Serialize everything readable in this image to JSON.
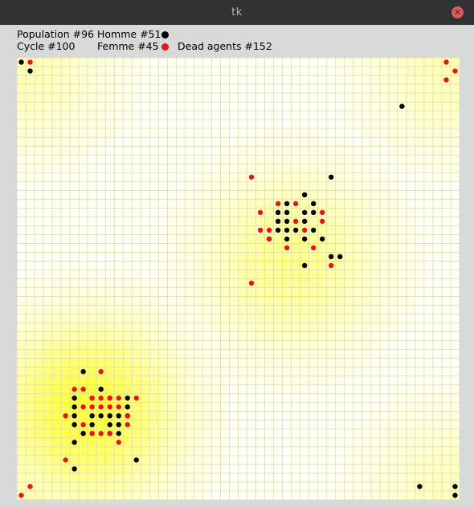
{
  "window": {
    "title": "tk",
    "close_glyph": "✕"
  },
  "stats": {
    "population": "Population #96",
    "cycle": "Cycle #100",
    "homme": "Homme #51",
    "femme": "Femme #45",
    "dead": "Dead agents #152"
  },
  "colors": {
    "homme": "#000000",
    "femme": "#e8141c",
    "hotspot": "#ffff33",
    "grid": "#dcdcb4"
  },
  "grid": {
    "columns": 50,
    "rows": 50
  },
  "resource_hotspots": [
    {
      "col": 7.5,
      "row": 39.5,
      "strength": 1.0
    },
    {
      "col": 30.5,
      "row": 22.5,
      "strength": 0.55
    },
    {
      "col": 0,
      "row": 0,
      "strength": 0.35
    },
    {
      "col": 49,
      "row": 0,
      "strength": 0.35
    },
    {
      "col": 0,
      "row": 49,
      "strength": 0.35
    },
    {
      "col": 49,
      "row": 49,
      "strength": 0.3
    }
  ],
  "agents": {
    "homme": [
      [
        0,
        0
      ],
      [
        1,
        1
      ],
      [
        43,
        5
      ],
      [
        35,
        13
      ],
      [
        32,
        15
      ],
      [
        30,
        16
      ],
      [
        33,
        16
      ],
      [
        29,
        17
      ],
      [
        30,
        17
      ],
      [
        32,
        17
      ],
      [
        33,
        17
      ],
      [
        29,
        18
      ],
      [
        30,
        18
      ],
      [
        32,
        18
      ],
      [
        29,
        19
      ],
      [
        30,
        19
      ],
      [
        31,
        19
      ],
      [
        33,
        19
      ],
      [
        28,
        20
      ],
      [
        30,
        20
      ],
      [
        32,
        20
      ],
      [
        34,
        20
      ],
      [
        35,
        22
      ],
      [
        36,
        22
      ],
      [
        32,
        23
      ],
      [
        7,
        35
      ],
      [
        9,
        37
      ],
      [
        6,
        38
      ],
      [
        8,
        38
      ],
      [
        10,
        38
      ],
      [
        12,
        38
      ],
      [
        6,
        39
      ],
      [
        12,
        39
      ],
      [
        6,
        40
      ],
      [
        8,
        40
      ],
      [
        9,
        40
      ],
      [
        10,
        40
      ],
      [
        11,
        40
      ],
      [
        12,
        40
      ],
      [
        6,
        41
      ],
      [
        8,
        41
      ],
      [
        10,
        41
      ],
      [
        11,
        41
      ],
      [
        7,
        42
      ],
      [
        10,
        42
      ],
      [
        11,
        42
      ],
      [
        6,
        43
      ],
      [
        13,
        45
      ],
      [
        6,
        46
      ],
      [
        45,
        48
      ],
      [
        49,
        48
      ],
      [
        49,
        49
      ]
    ],
    "femme": [
      [
        1,
        0
      ],
      [
        48,
        0
      ],
      [
        49,
        1
      ],
      [
        48,
        2
      ],
      [
        26,
        13
      ],
      [
        29,
        16
      ],
      [
        31,
        16
      ],
      [
        27,
        17
      ],
      [
        34,
        17
      ],
      [
        31,
        18
      ],
      [
        34,
        18
      ],
      [
        27,
        19
      ],
      [
        28,
        19
      ],
      [
        32,
        19
      ],
      [
        28,
        20
      ],
      [
        30,
        21
      ],
      [
        33,
        21
      ],
      [
        35,
        23
      ],
      [
        26,
        25
      ],
      [
        9,
        35
      ],
      [
        6,
        37
      ],
      [
        7,
        37
      ],
      [
        8,
        38
      ],
      [
        9,
        38
      ],
      [
        10,
        38
      ],
      [
        11,
        38
      ],
      [
        13,
        38
      ],
      [
        7,
        39
      ],
      [
        8,
        39
      ],
      [
        9,
        39
      ],
      [
        10,
        39
      ],
      [
        11,
        39
      ],
      [
        5,
        40
      ],
      [
        12,
        40
      ],
      [
        7,
        41
      ],
      [
        12,
        41
      ],
      [
        8,
        42
      ],
      [
        9,
        42
      ],
      [
        10,
        42
      ],
      [
        11,
        43
      ],
      [
        5,
        45
      ],
      [
        1,
        48
      ],
      [
        0,
        49
      ]
    ]
  }
}
